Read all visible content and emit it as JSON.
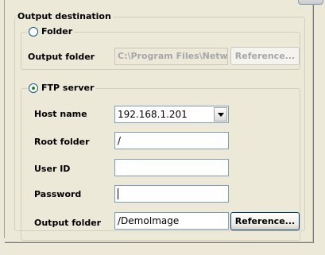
{
  "output_destination": {
    "title": "Output destination",
    "folder": {
      "radio_label": "Folder",
      "checked": false,
      "output_folder_label": "Output folder",
      "output_folder_value": "C:\\Program Files\\Network",
      "reference_button": "Reference..."
    },
    "ftp": {
      "radio_label": "FTP server",
      "checked": true,
      "host_name_label": "Host name",
      "host_name_value": "192.168.1.201",
      "root_folder_label": "Root folder",
      "root_folder_value": "/",
      "user_id_label": "User ID",
      "user_id_value": "",
      "password_label": "Password",
      "password_value": "",
      "output_folder_label": "Output folder",
      "output_folder_value": "/DemoImage",
      "reference_button": "Reference..."
    }
  }
}
